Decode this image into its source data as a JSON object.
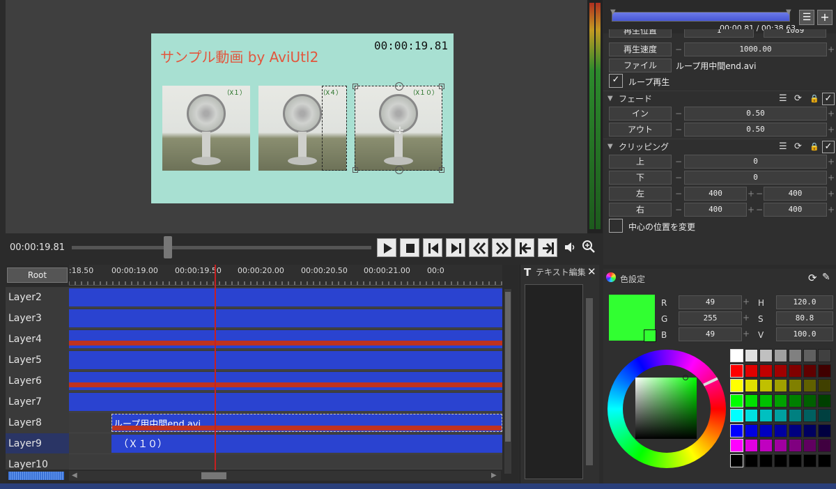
{
  "preview": {
    "video_title": "サンプル動画 by AviUtl2",
    "video_time": "00:00:19.81",
    "thumbs": [
      {
        "tag": "（X１）"
      },
      {
        "tag": "（X４）"
      },
      {
        "tag": "（X１０）"
      }
    ]
  },
  "transport": {
    "current_time": "00:00:19.81"
  },
  "timeline": {
    "root_label": "Root",
    "ticks": [
      ":18.50",
      "00:00:19.00",
      "00:00:19.50",
      "00:00:20.00",
      "00:00:20.50",
      "00:00:21.00",
      "00:0"
    ],
    "layers": [
      {
        "name": "Layer2"
      },
      {
        "name": "Layer3"
      },
      {
        "name": "Layer4"
      },
      {
        "name": "Layer5"
      },
      {
        "name": "Layer6"
      },
      {
        "name": "Layer7"
      },
      {
        "name": "Layer8"
      },
      {
        "name": "Layer9"
      },
      {
        "name": "Layer10"
      }
    ],
    "clip_layer8_label": "ループ用中間end.avi",
    "clip_layer9_label": "（Ｘ１０）"
  },
  "text_panel": {
    "title": "テキスト編集"
  },
  "playback": {
    "position_text": "00:00.81 / 00:38.63",
    "progress_fraction": 0.021
  },
  "props": {
    "partial_label": "再生位置",
    "partial_val1": "1",
    "partial_val2": "1089",
    "speed_label": "再生速度",
    "speed_value": "1000.00",
    "file_label": "ファイル",
    "file_value": "ループ用中間end.avi",
    "loop_label": "ループ再生",
    "fade_section": "フェード",
    "fade_in_label": "イン",
    "fade_in_value": "0.50",
    "fade_out_label": "アウト",
    "fade_out_value": "0.50",
    "clip_section": "クリッピング",
    "top_label": "上",
    "top_value": "0",
    "bottom_label": "下",
    "bottom_value": "0",
    "left_label": "左",
    "left_value1": "400",
    "left_value2": "400",
    "right_label": "右",
    "right_value1": "400",
    "right_value2": "400",
    "center_label": "中心の位置を変更"
  },
  "color": {
    "title": "色設定",
    "r_label": "R",
    "r_value": "49",
    "g_label": "G",
    "g_value": "255",
    "b_label": "B",
    "b_value": "49",
    "h_label": "H",
    "h_value": "120.0",
    "s_label": "S",
    "s_value": "80.8",
    "v_label": "V",
    "v_value": "100.0",
    "current_color": "#31ff31"
  }
}
